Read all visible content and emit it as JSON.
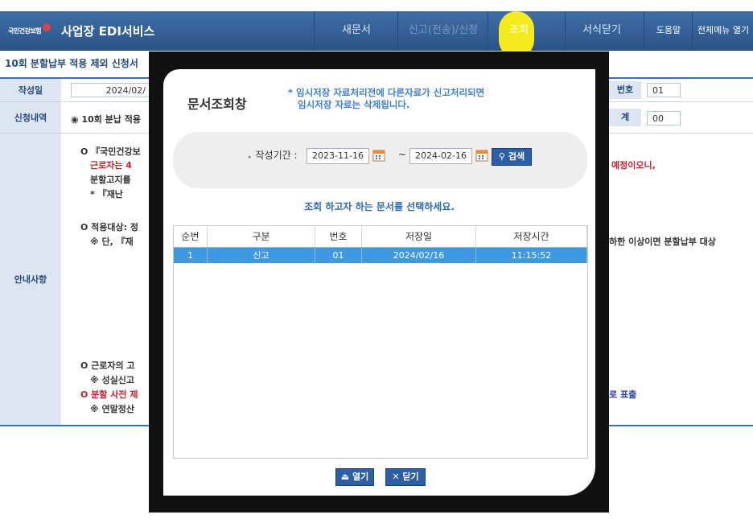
{
  "header": {
    "logo_text": "국민건강보험",
    "app_title": "사업장 EDI서비스",
    "nav": [
      {
        "label": "새문서"
      },
      {
        "label": "신고(전송)/신청"
      },
      {
        "label": "조회"
      },
      {
        "label": "서식닫기"
      },
      {
        "label": "도움말"
      },
      {
        "label": "전체메뉴 열기"
      }
    ],
    "highlight_color": "#f4ea1c",
    "brand_color": "#2a5489"
  },
  "page": {
    "title": "10회 분할납부 적용 제외 신청서",
    "rows": {
      "written_date_label": "작성일",
      "written_date_value": "2024/02/",
      "number_label": "번호",
      "number_value": "01",
      "request_label": "신청내역",
      "request_value": "◉ 10회 분납 적용",
      "count_label": "계",
      "count_value": "00",
      "notice_label": "안내사항"
    },
    "notice_lines": [
      "O 『국민건강보",
      "근로자는 4",
      "예정이오니,",
      "분할고지를",
      "* 『재난",
      "O 적용대상: 정",
      "※ 단, 『재",
      "하한 이상이면 분할납부 대상",
      "O 근로자의 고",
      "※ 성실신고",
      "O 분할 사전 제",
      "로 표출",
      "※ 연말정산"
    ]
  },
  "modal": {
    "title": "문서조회창",
    "note_line1": "* 임시저장 자료처리전에 다른자료가 신고처리되면",
    "note_line2": "임시저장 자료는 삭제됩니다.",
    "period_label": "작성기간 :",
    "date_from": "2023-11-16",
    "date_to": "2024-02-16",
    "tilde": "~",
    "search_label": "검색",
    "select_prompt": "조회 하고자 하는 문서를 선택하세요.",
    "columns": [
      "순번",
      "구분",
      "번호",
      "저장일",
      "저장시간"
    ],
    "rows": [
      [
        "1",
        "신고",
        "01",
        "2024/02/16",
        "11:15:52"
      ]
    ],
    "open_label": "열기",
    "close_label": "닫기"
  }
}
